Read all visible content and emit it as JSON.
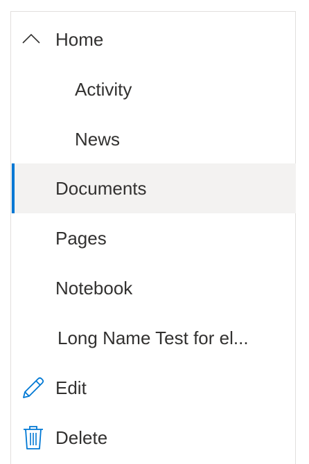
{
  "nav": {
    "home": {
      "label": "Home",
      "icon": "chevron-up-icon",
      "expanded": true
    },
    "children": [
      {
        "label": "Activity"
      },
      {
        "label": "News"
      }
    ],
    "documents": {
      "label": "Documents",
      "selected": true
    },
    "pages": {
      "label": "Pages"
    },
    "notebook": {
      "label": "Notebook"
    },
    "long_name": {
      "label": "Long Name Test for el..."
    },
    "edit": {
      "label": "Edit",
      "icon": "pencil-icon"
    },
    "delete": {
      "label": "Delete",
      "icon": "trash-icon"
    }
  },
  "colors": {
    "accent": "#0078d4",
    "selected_background": "#f3f2f1",
    "text": "#323130",
    "border": "#e1dfdd"
  }
}
